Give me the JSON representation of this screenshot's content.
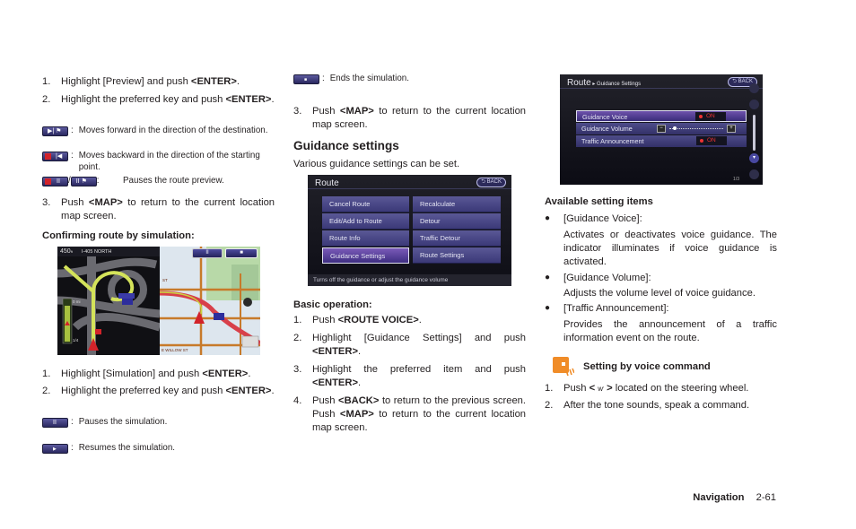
{
  "column1": {
    "preview_steps": [
      {
        "num": "1.",
        "pre": "Highlight [Preview] and push ",
        "key": "<ENTER>",
        "post": "."
      },
      {
        "num": "2.",
        "pre": "Highlight the preferred key and push ",
        "key": "<ENTER>",
        "post": "."
      }
    ],
    "preview_keys": [
      {
        "icon": "forward-key-icon",
        "desc": "Moves forward in the direction of the destination."
      },
      {
        "icon": "backward-key-icon",
        "desc": "Moves backward in the direction of the starting point."
      },
      {
        "icon": "pause-preview-keys-icon",
        "separator": "/",
        "desc": "Pauses the route preview."
      }
    ],
    "preview_step3": {
      "num": "3.",
      "pre": "Push ",
      "key": "<MAP>",
      "post": " to return to the current location map screen."
    },
    "simulation_heading": "Confirming route by simulation:",
    "simulation_screen": {
      "distance": "450",
      "distance_unit": "ft",
      "road": "I-405 NORTH",
      "shield_label": "NORTH",
      "shield_number": "405",
      "scale_top": "0 mi",
      "scale_bottom": "1/4",
      "street_1": "ST",
      "street_2": "E WILLOW ST",
      "pause_glyph": "II",
      "stop_glyph": "■"
    },
    "simulation_steps": [
      {
        "num": "1.",
        "pre": "Highlight [Simulation] and push ",
        "key": "<ENTER>",
        "post": "."
      },
      {
        "num": "2.",
        "pre": "Highlight the preferred key and push ",
        "key": "<ENTER>",
        "post": "."
      }
    ],
    "simulation_keys": [
      {
        "icon": "pause-simulation-key-icon",
        "glyph": "II",
        "desc": "Pauses the simulation."
      },
      {
        "icon": "resume-simulation-key-icon",
        "glyph": "▶",
        "desc": "Resumes the simulation."
      }
    ]
  },
  "column2": {
    "end_key": {
      "icon": "stop-simulation-key-icon",
      "glyph": "■",
      "desc": "Ends the simulation."
    },
    "step3": {
      "num": "3.",
      "pre": "Push ",
      "key": "<MAP>",
      "post": " to return to the current location map screen."
    },
    "heading": "Guidance settings",
    "intro": "Various guidance settings can be set.",
    "route_screen": {
      "title": "Route",
      "back_label": "BACK",
      "items_left": [
        "Cancel Route",
        "Edit/Add to Route",
        "Route Info",
        "Guidance Settings"
      ],
      "items_right": [
        "Recalculate",
        "Detour",
        "Traffic Detour",
        "Route Settings"
      ],
      "selected": "Guidance Settings",
      "footer": "Turns off the guidance or adjust the guidance volume"
    },
    "basic_heading": "Basic operation:",
    "basic_steps": [
      {
        "num": "1.",
        "pre": "Push ",
        "key": "<ROUTE VOICE>",
        "post": "."
      },
      {
        "num": "2.",
        "pre": "Highlight [Guidance Settings] and push ",
        "key": "<ENTER>",
        "post": "."
      },
      {
        "num": "3.",
        "pre": "Highlight the preferred item and push ",
        "key": "<ENTER>",
        "post": "."
      },
      {
        "num": "4.",
        "pre": "Push ",
        "key": "<BACK>",
        "mid": " to return to the previous screen. Push ",
        "key2": "<MAP>",
        "post": " to return to the current location map screen."
      }
    ]
  },
  "column3": {
    "settings_screen": {
      "title": "Route",
      "breadcrumb": "Guidance Settings",
      "back_label": "BACK",
      "rows": [
        {
          "label": "Guidance Voice",
          "value": "ON"
        },
        {
          "label": "Guidance Volume",
          "minus": "−",
          "plus": "+",
          "level": 0.1
        },
        {
          "label": "Traffic Announcement",
          "value": "ON"
        }
      ],
      "selected": "Guidance Voice",
      "page": "1/3"
    },
    "items_heading": "Available setting items",
    "items": [
      {
        "label": "[Guidance Voice]:",
        "desc": "Activates or deactivates voice guidance. The indicator illuminates if voice guidance is activated."
      },
      {
        "label": "[Guidance Volume]:",
        "desc": "Adjusts the volume level of voice guidance."
      },
      {
        "label": "[Traffic Announcement]:",
        "desc": "Provides the announcement of a traffic information event on the route."
      }
    ],
    "voice_heading": "Setting by voice command",
    "voice_steps": [
      {
        "num": "1.",
        "pre": "Push ",
        "key": "< ",
        "icon_glyph": "ⱳ",
        "key_end": " >",
        "post": " located on the steering wheel."
      },
      {
        "num": "2.",
        "text": "After the tone sounds, speak a command."
      }
    ],
    "voice_color": "#f08c28"
  },
  "footer": {
    "section": "Navigation",
    "page": "2-61"
  }
}
